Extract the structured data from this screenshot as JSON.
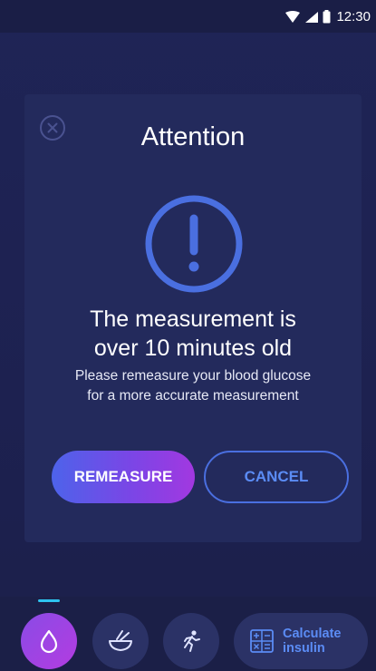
{
  "status_bar": {
    "time": "12:30",
    "icons": [
      "wifi-icon",
      "signal-icon",
      "battery-icon"
    ]
  },
  "dialog": {
    "title": "Attention",
    "heading_line1": "The measurement is",
    "heading_line2": "over 10 minutes old",
    "body_line1": "Please remeasure your blood glucose",
    "body_line2": "for a more accurate measurement",
    "primary_button": "REMEASURE",
    "secondary_button": "CANCEL",
    "close_icon": "close-icon",
    "alert_icon": "exclamation-circle-icon"
  },
  "bottom_nav": {
    "items": [
      {
        "name": "glucose",
        "icon": "drop-icon",
        "active": true
      },
      {
        "name": "meal",
        "icon": "bowl-icon",
        "active": false
      },
      {
        "name": "activity",
        "icon": "running-icon",
        "active": false
      }
    ],
    "calc_label_line1": "Calculate",
    "calc_label_line2": "insulin",
    "calc_icon": "calculator-icon"
  },
  "colors": {
    "background": "#1e2350",
    "dialog": "#232a5c",
    "accent_blue": "#5b8cf5",
    "accent_purple": "#a238e0",
    "indicator": "#2ec4f0"
  }
}
